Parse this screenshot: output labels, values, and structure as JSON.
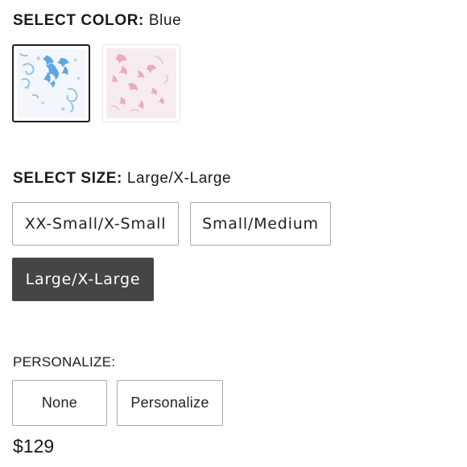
{
  "color": {
    "label": "SELECT COLOR:",
    "selected_value": "Blue",
    "swatches": [
      {
        "name": "Blue",
        "primary": "#4a9ad8",
        "background": "#f4f7fb",
        "selected": true
      },
      {
        "name": "Pink",
        "primary": "#e49ab0",
        "background": "#f7eef1",
        "selected": false
      }
    ]
  },
  "size": {
    "label": "SELECT SIZE:",
    "selected_value": "Large/X-Large",
    "options": [
      {
        "label": "XX-Small/X-Small",
        "selected": false
      },
      {
        "label": "Small/Medium",
        "selected": false
      },
      {
        "label": "Large/X-Large",
        "selected": true
      }
    ]
  },
  "personalize": {
    "label": "PERSONALIZE:",
    "options": [
      {
        "label": "None"
      },
      {
        "label": "Personalize"
      }
    ]
  },
  "price": "$129",
  "colors": {
    "selected_button_bg": "#454545",
    "button_border": "#a9a9a9",
    "text": "#1a1a1a"
  }
}
